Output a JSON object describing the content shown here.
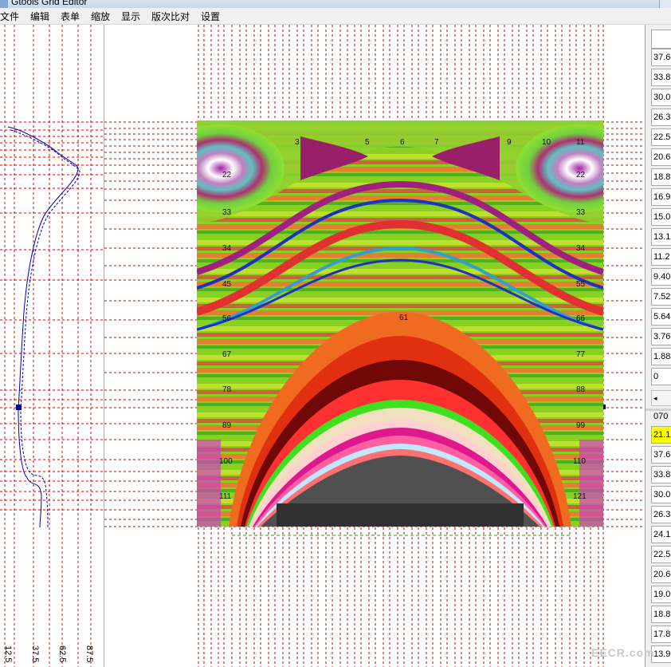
{
  "window": {
    "title": "Gtools Grid Editor"
  },
  "menu": [
    "文件",
    "编辑",
    "表单",
    "缩放",
    "显示",
    "版次比对",
    "设置"
  ],
  "left_panel": {
    "axis_ticks": [
      "12.5",
      "37.5",
      "62.5",
      "87.5"
    ]
  },
  "grid_view": {
    "contour_labels": [
      {
        "text": "3"
      },
      {
        "text": "5"
      },
      {
        "text": "6"
      },
      {
        "text": "7"
      },
      {
        "text": "9"
      },
      {
        "text": "10"
      },
      {
        "text": "11"
      },
      {
        "text": "22"
      },
      {
        "text": "22"
      },
      {
        "text": "33"
      },
      {
        "text": "33"
      },
      {
        "text": "34"
      },
      {
        "text": "34"
      },
      {
        "text": "45"
      },
      {
        "text": "55"
      },
      {
        "text": "56"
      },
      {
        "text": "66"
      },
      {
        "text": "61"
      },
      {
        "text": "67"
      },
      {
        "text": "77"
      },
      {
        "text": "78"
      },
      {
        "text": "88"
      },
      {
        "text": "89"
      },
      {
        "text": "99"
      },
      {
        "text": "100"
      },
      {
        "text": "110"
      },
      {
        "text": "111"
      },
      {
        "text": "121"
      }
    ]
  },
  "right_panel": {
    "upper_values": [
      "37.6",
      "33.8",
      "30.0",
      "26.3",
      "22.5",
      "20.6",
      "18.8",
      "16.9",
      "15.0",
      "13.1",
      "11.2",
      "9.40",
      "7.52",
      "5.64",
      "3.76",
      "1.88",
      "0"
    ],
    "section_label": "070",
    "lower_values": [
      "21.1",
      "37.6",
      "33.8",
      "30.0",
      "26.3",
      "24.1",
      "22.5",
      "20.6",
      "19.0",
      "18.8",
      "17.8",
      "13.9"
    ],
    "highlight_color": "#ffff00"
  },
  "watermark": "EECR.com",
  "colors": {
    "grid_line": "#d40000",
    "curve": "#0000aa"
  }
}
